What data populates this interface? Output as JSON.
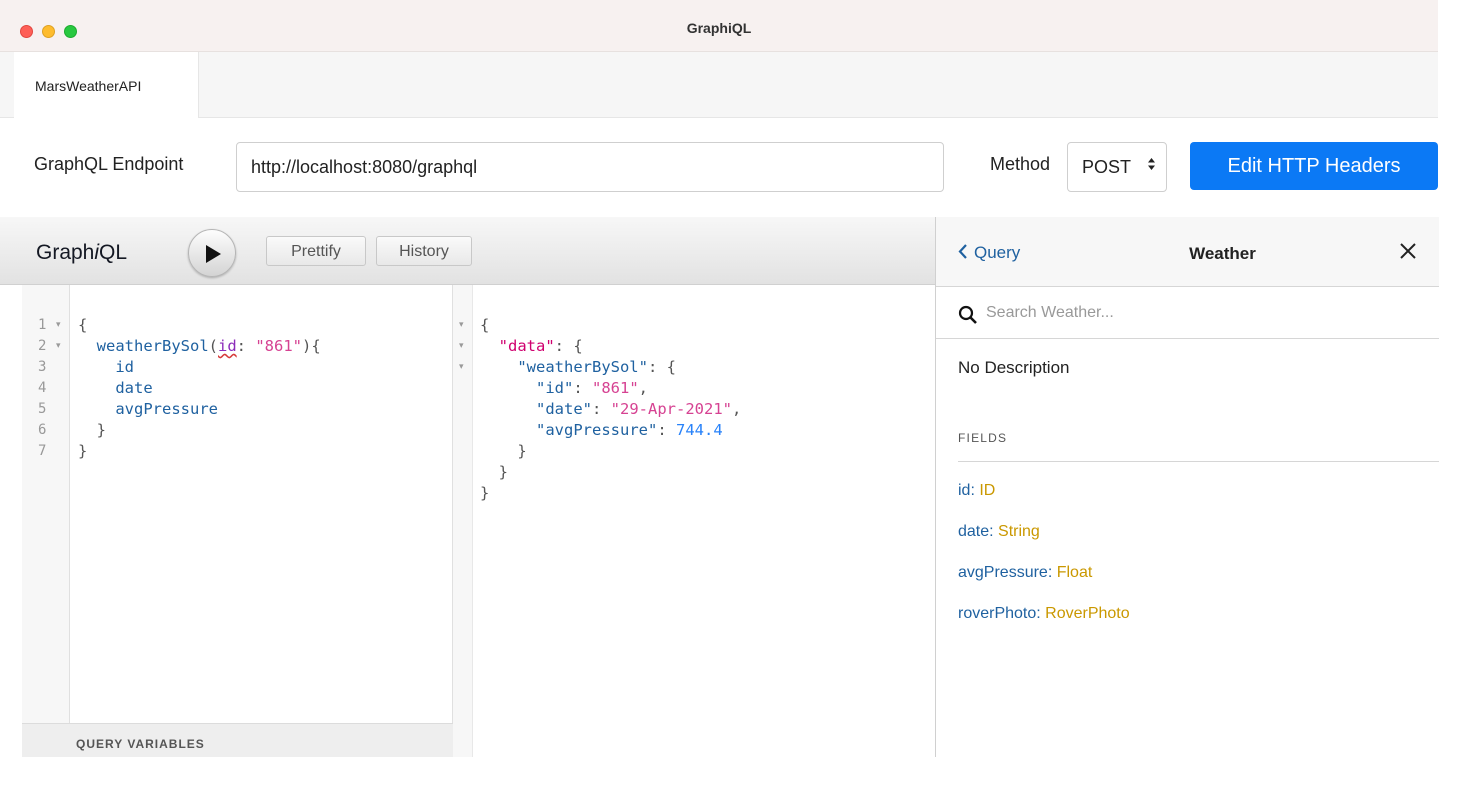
{
  "window": {
    "title": "GraphiQL"
  },
  "tabs": [
    {
      "label": "MarsWeatherAPI"
    }
  ],
  "endpoint": {
    "label": "GraphQL Endpoint",
    "url": "http://localhost:8080/graphql"
  },
  "method": {
    "label": "Method",
    "value": "POST",
    "arrows": "▲▼"
  },
  "headers_button": {
    "label": "Edit HTTP Headers",
    "color": "#0b79f5"
  },
  "toolbar": {
    "title_prefix": "Graph",
    "title_italic": "i",
    "title_suffix": "QL",
    "prettify_label": "Prettify",
    "history_label": "History",
    "run_icon": "play-icon"
  },
  "query": {
    "line_numbers": [
      "1",
      "2",
      "3",
      "4",
      "5",
      "6",
      "7"
    ],
    "lines": [
      {
        "parts": [
          {
            "t": "{",
            "c": "punct"
          }
        ]
      },
      {
        "parts": [
          {
            "t": "  ",
            "c": "punct"
          },
          {
            "t": "weatherBySol",
            "c": "field"
          },
          {
            "t": "(",
            "c": "punct"
          },
          {
            "t": "id",
            "c": "arg"
          },
          {
            "t": ": ",
            "c": "punct"
          },
          {
            "t": "\"861\"",
            "c": "str"
          },
          {
            "t": "){",
            "c": "punct"
          }
        ]
      },
      {
        "parts": [
          {
            "t": "    ",
            "c": "punct"
          },
          {
            "t": "id",
            "c": "field"
          }
        ]
      },
      {
        "parts": [
          {
            "t": "    ",
            "c": "punct"
          },
          {
            "t": "date",
            "c": "field"
          }
        ]
      },
      {
        "parts": [
          {
            "t": "    ",
            "c": "punct"
          },
          {
            "t": "avgPressure",
            "c": "field"
          }
        ]
      },
      {
        "parts": [
          {
            "t": "  }",
            "c": "punct"
          }
        ]
      },
      {
        "parts": [
          {
            "t": "}",
            "c": "punct"
          }
        ]
      }
    ],
    "variables_label": "QUERY VARIABLES"
  },
  "result": {
    "lines": [
      {
        "parts": [
          {
            "t": "{",
            "c": "punct"
          }
        ]
      },
      {
        "parts": [
          {
            "t": "  ",
            "c": "punct"
          },
          {
            "t": "\"data\"",
            "c": "data"
          },
          {
            "t": ": {",
            "c": "punct"
          }
        ]
      },
      {
        "parts": [
          {
            "t": "    ",
            "c": "punct"
          },
          {
            "t": "\"weatherBySol\"",
            "c": "key"
          },
          {
            "t": ": {",
            "c": "punct"
          }
        ]
      },
      {
        "parts": [
          {
            "t": "      ",
            "c": "punct"
          },
          {
            "t": "\"id\"",
            "c": "key"
          },
          {
            "t": ": ",
            "c": "punct"
          },
          {
            "t": "\"861\"",
            "c": "str"
          },
          {
            "t": ",",
            "c": "punct"
          }
        ]
      },
      {
        "parts": [
          {
            "t": "      ",
            "c": "punct"
          },
          {
            "t": "\"date\"",
            "c": "key"
          },
          {
            "t": ": ",
            "c": "punct"
          },
          {
            "t": "\"29-Apr-2021\"",
            "c": "str"
          },
          {
            "t": ",",
            "c": "punct"
          }
        ]
      },
      {
        "parts": [
          {
            "t": "      ",
            "c": "punct"
          },
          {
            "t": "\"avgPressure\"",
            "c": "key"
          },
          {
            "t": ": ",
            "c": "punct"
          },
          {
            "t": "744.4",
            "c": "num"
          }
        ]
      },
      {
        "parts": [
          {
            "t": "    }",
            "c": "punct"
          }
        ]
      },
      {
        "parts": [
          {
            "t": "  }",
            "c": "punct"
          }
        ]
      },
      {
        "parts": [
          {
            "t": "}",
            "c": "punct"
          }
        ]
      }
    ]
  },
  "docs": {
    "back_label": "Query",
    "title": "Weather",
    "search_placeholder": "Search Weather...",
    "description": "No Description",
    "fields_heading": "FIELDS",
    "fields": [
      {
        "name": "id",
        "type": "ID"
      },
      {
        "name": "date",
        "type": "String"
      },
      {
        "name": "avgPressure",
        "type": "Float"
      },
      {
        "name": "roverPhoto",
        "type": "RoverPhoto"
      }
    ]
  },
  "colors": {
    "field": "#1f61a0",
    "arg": "#8b2bb9",
    "string": "#d64292",
    "number": "#2882f9",
    "type": "#ca9800",
    "data_key": "#d0006f"
  }
}
